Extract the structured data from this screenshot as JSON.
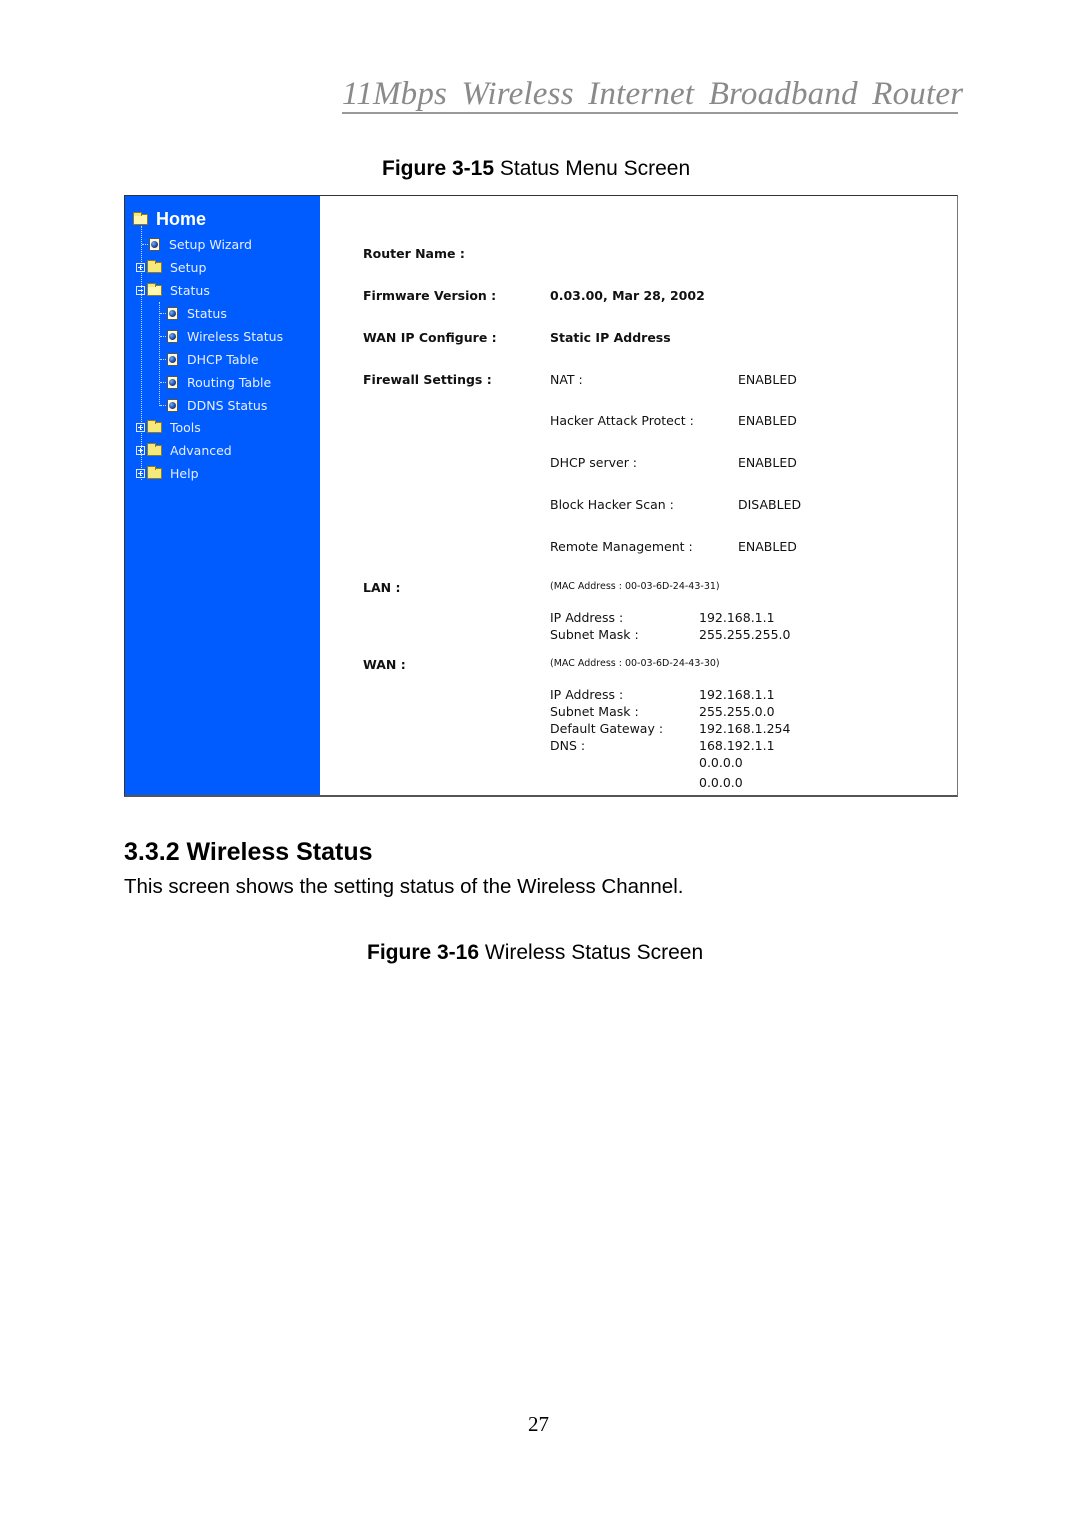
{
  "header": {
    "running_title": "11Mbps  Wireless  Internet  Broadband  Router"
  },
  "figure_15": {
    "label": "Figure 3-15",
    "caption": " Status Menu Screen"
  },
  "router_ui": {
    "sidebar": {
      "home": "Home",
      "items": [
        {
          "label": "Setup Wizard",
          "icon": "page-icon",
          "level": 1
        },
        {
          "label": "Setup",
          "icon": "folder-icon",
          "level": 1,
          "expander": "plus"
        },
        {
          "label": "Status",
          "icon": "folder-open-icon",
          "level": 1,
          "expander": "minus"
        },
        {
          "label": "Status",
          "icon": "page-icon",
          "level": 2
        },
        {
          "label": "Wireless Status",
          "icon": "page-icon",
          "level": 2
        },
        {
          "label": "DHCP Table",
          "icon": "page-icon",
          "level": 2
        },
        {
          "label": "Routing Table",
          "icon": "page-icon",
          "level": 2
        },
        {
          "label": "DDNS Status",
          "icon": "page-icon",
          "level": 2
        },
        {
          "label": "Tools",
          "icon": "folder-icon",
          "level": 1,
          "expander": "plus"
        },
        {
          "label": "Advanced",
          "icon": "folder-icon",
          "level": 1,
          "expander": "plus"
        },
        {
          "label": "Help",
          "icon": "folder-icon",
          "level": 1,
          "expander": "plus"
        }
      ],
      "bg_color": "#005cff"
    },
    "status": {
      "router_name_label": "Router Name :",
      "router_name_value": "",
      "firmware_label": "Firmware Version :",
      "firmware_value": "0.03.00, Mar 28, 2002",
      "wan_ip_config_label": "WAN IP Configure :",
      "wan_ip_config_value": "Static IP Address",
      "firewall_label": "Firewall Settings :",
      "firewall": [
        {
          "name": "NAT :",
          "value": "ENABLED"
        },
        {
          "name": "Hacker Attack Protect :",
          "value": "ENABLED"
        },
        {
          "name": "DHCP server :",
          "value": "ENABLED"
        },
        {
          "name": "Block Hacker Scan :",
          "value": "DISABLED"
        },
        {
          "name": "Remote Management :",
          "value": "ENABLED"
        }
      ],
      "lan": {
        "label": "LAN :",
        "mac": "(MAC Address : 00-03-6D-24-43-31)",
        "ip_label": "IP Address :",
        "ip_value": "192.168.1.1",
        "mask_label": "Subnet Mask :",
        "mask_value": "255.255.255.0"
      },
      "wan": {
        "label": "WAN :",
        "mac": "(MAC Address : 00-03-6D-24-43-30)",
        "ip_label": "IP Address :",
        "ip_value": "192.168.1.1",
        "mask_label": "Subnet Mask :",
        "mask_value": "255.255.0.0",
        "gateway_label": "Default Gateway :",
        "gateway_value": "192.168.1.254",
        "dns_label": "DNS :",
        "dns_values": [
          "168.192.1.1",
          "0.0.0.0",
          "0.0.0.0"
        ]
      }
    }
  },
  "section": {
    "heading": "3.3.2 Wireless Status",
    "body": "This screen shows the setting status of the Wireless Channel."
  },
  "figure_16": {
    "label": "Figure 3-16",
    "caption": " Wireless Status Screen"
  },
  "page_number": "27"
}
